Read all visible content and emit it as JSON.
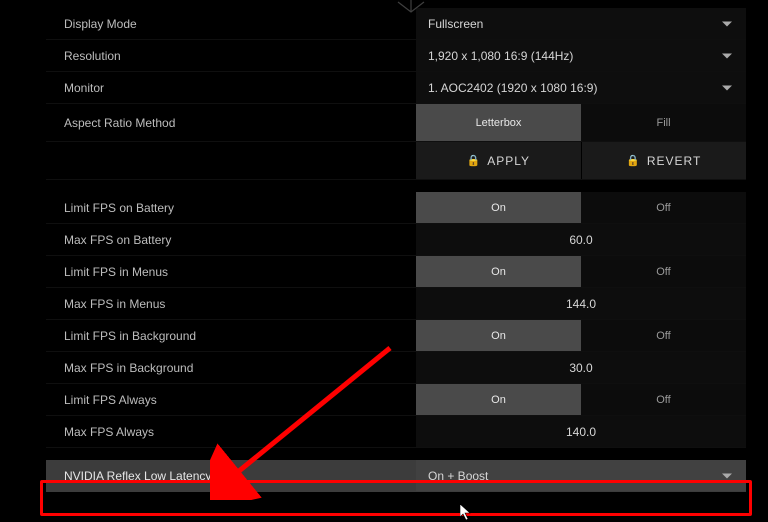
{
  "display_mode": {
    "label": "Display Mode",
    "value": "Fullscreen"
  },
  "resolution": {
    "label": "Resolution",
    "value": "1,920 x 1,080 16:9 (144Hz)"
  },
  "monitor": {
    "label": "Monitor",
    "value": "1. AOC2402 (1920 x  1080 16:9)"
  },
  "aspect_ratio": {
    "label": "Aspect Ratio Method",
    "opt1": "Letterbox",
    "opt2": "Fill"
  },
  "apply": "APPLY",
  "revert": "REVERT",
  "limit_fps_battery": {
    "label": "Limit FPS on Battery",
    "on": "On",
    "off": "Off"
  },
  "max_fps_battery": {
    "label": "Max FPS on Battery",
    "value": "60.0"
  },
  "limit_fps_menus": {
    "label": "Limit FPS in Menus",
    "on": "On",
    "off": "Off"
  },
  "max_fps_menus": {
    "label": "Max FPS in Menus",
    "value": "144.0"
  },
  "limit_fps_bg": {
    "label": "Limit FPS in Background",
    "on": "On",
    "off": "Off"
  },
  "max_fps_bg": {
    "label": "Max FPS in Background",
    "value": "30.0"
  },
  "limit_fps_always": {
    "label": "Limit FPS Always",
    "on": "On",
    "off": "Off"
  },
  "max_fps_always": {
    "label": "Max FPS Always",
    "value": "140.0"
  },
  "reflex": {
    "label": "NVIDIA Reflex Low Latency",
    "value": "On + Boost"
  }
}
